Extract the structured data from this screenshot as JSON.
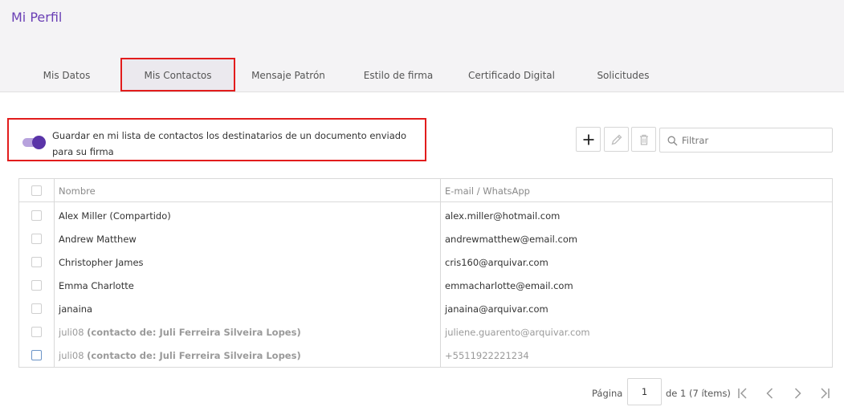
{
  "header": {
    "title": "Mi Perfil"
  },
  "tabs": [
    {
      "label": "Mis Datos"
    },
    {
      "label": "Mis Contactos"
    },
    {
      "label": "Mensaje Patrón"
    },
    {
      "label": "Estilo de firma"
    },
    {
      "label": "Certificado Digital"
    },
    {
      "label": "Solicitudes"
    }
  ],
  "active_tab": "Mis Contactos",
  "settings": {
    "save_recipients_label": "Guardar en mi lista de contactos los destinatarios de un documento enviado para su firma",
    "save_recipients_enabled": true
  },
  "toolbar": {
    "add_icon": "plus-icon",
    "edit_icon": "pencil-icon",
    "delete_icon": "trash-icon",
    "search_icon": "search-icon",
    "filter_placeholder": "Filtrar"
  },
  "table": {
    "columns": [
      "Nombre",
      "E-mail / WhatsApp"
    ],
    "rows": [
      {
        "name": "Alex Miller (Compartido)",
        "note": "",
        "contact": "alex.miller@hotmail.com"
      },
      {
        "name": "Andrew Matthew",
        "note": "",
        "contact": "andrewmatthew@email.com"
      },
      {
        "name": "Christopher James",
        "note": "",
        "contact": "cris160@arquivar.com"
      },
      {
        "name": "Emma Charlotte",
        "note": "",
        "contact": "emmacharlotte@email.com"
      },
      {
        "name": "janaina",
        "note": "",
        "contact": "janaina@arquivar.com"
      },
      {
        "name": "juli08",
        "note": "(contacto de: Juli Ferreira Silveira Lopes)",
        "contact": "juliene.guarento@arquivar.com"
      },
      {
        "name": "juli08",
        "note": "(contacto de: Juli Ferreira Silveira Lopes)",
        "contact": "+5511922221234"
      }
    ]
  },
  "pagination": {
    "page_label": "Página",
    "current_page": "1",
    "summary": "de 1 (7 ítems)"
  },
  "colors": {
    "accent": "#6a3fb5",
    "highlight_border": "#e21c1c",
    "toggle_knob": "#5a34a8",
    "toggle_track": "#b7a2dd"
  }
}
